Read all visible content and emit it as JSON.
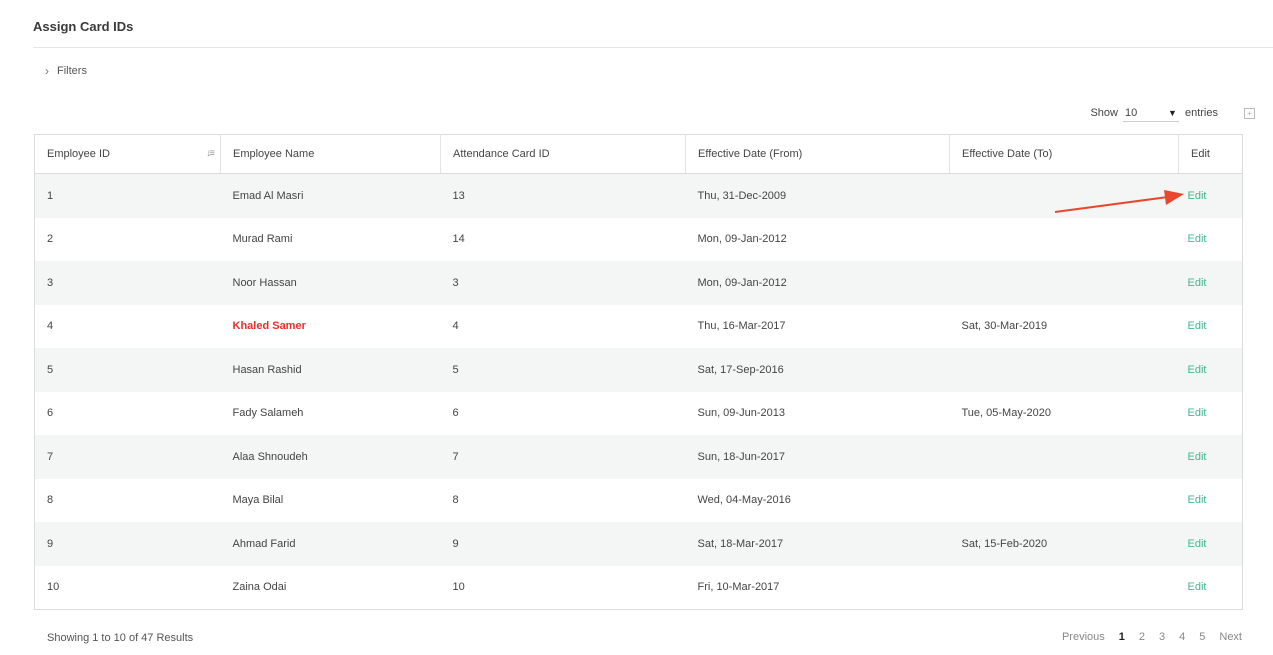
{
  "page": {
    "title": "Assign Card IDs"
  },
  "filters": {
    "label": "Filters"
  },
  "length_menu": {
    "show_label": "Show",
    "value": "10",
    "entries_label": "entries"
  },
  "table": {
    "headers": [
      "Employee ID",
      "Employee Name",
      "Attendance Card ID",
      "Effective Date (From)",
      "Effective Date (To)",
      "Edit"
    ],
    "rows": [
      {
        "id": "1",
        "name": "Emad Al Masri",
        "card": "13",
        "from": "Thu, 31-Dec-2009",
        "to": "",
        "edit": "Edit"
      },
      {
        "id": "2",
        "name": "Murad Rami",
        "card": "14",
        "from": "Mon, 09-Jan-2012",
        "to": "",
        "edit": "Edit"
      },
      {
        "id": "3",
        "name": "Noor Hassan",
        "card": "3",
        "from": "Mon, 09-Jan-2012",
        "to": "",
        "edit": "Edit"
      },
      {
        "id": "4",
        "name": "Khaled Samer",
        "card": "4",
        "from": "Thu, 16-Mar-2017",
        "to": "Sat, 30-Mar-2019",
        "edit": "Edit"
      },
      {
        "id": "5",
        "name": "Hasan Rashid",
        "card": "5",
        "from": "Sat, 17-Sep-2016",
        "to": "",
        "edit": "Edit"
      },
      {
        "id": "6",
        "name": "Fady Salameh",
        "card": "6",
        "from": "Sun, 09-Jun-2013",
        "to": "Tue, 05-May-2020",
        "edit": "Edit"
      },
      {
        "id": "7",
        "name": "Alaa Shnoudeh",
        "card": "7",
        "from": "Sun, 18-Jun-2017",
        "to": "",
        "edit": "Edit"
      },
      {
        "id": "8",
        "name": "Maya Bilal",
        "card": "8",
        "from": "Wed, 04-May-2016",
        "to": "",
        "edit": "Edit"
      },
      {
        "id": "9",
        "name": "Ahmad Farid",
        "card": "9",
        "from": "Sat, 18-Mar-2017",
        "to": "Sat, 15-Feb-2020",
        "edit": "Edit"
      },
      {
        "id": "10",
        "name": "Zaina Odai",
        "card": "10",
        "from": "Fri, 10-Mar-2017",
        "to": "",
        "edit": "Edit"
      }
    ]
  },
  "footer": {
    "info": "Showing 1 to 10 of 47 Results",
    "pagination": {
      "previous": "Previous",
      "pages": [
        "1",
        "2",
        "3",
        "4",
        "5"
      ],
      "next": "Next",
      "current": "1"
    }
  },
  "colors": {
    "edit_link": "#3fb98e",
    "highlight_name": "#e8302b",
    "annotation_arrow": "#e8482f",
    "striped_row": "#f3f6f4"
  },
  "icons": {
    "filters_toggle": "chevron-right-icon",
    "sort": "sort-icon",
    "dropdown": "chevron-down-icon",
    "expand": "expand-icon"
  }
}
